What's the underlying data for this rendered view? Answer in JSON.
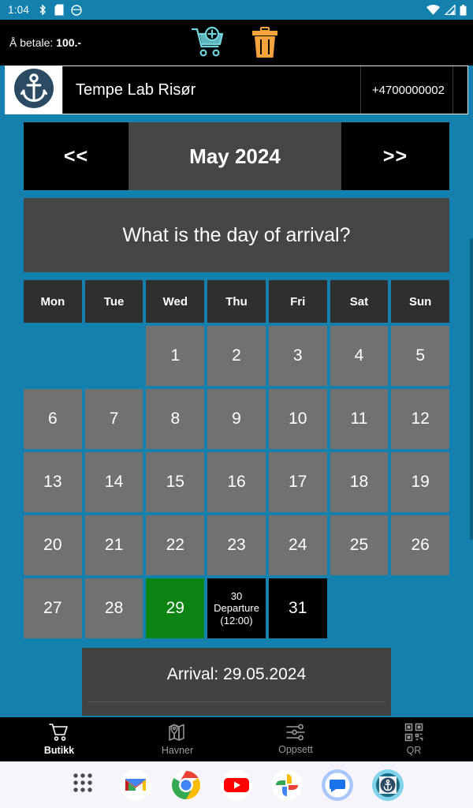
{
  "status_bar": {
    "time": "1:04",
    "icons": [
      "bluetooth-icon",
      "sd-card-icon",
      "circle-icon"
    ],
    "right_icons": [
      "wifi-icon",
      "cellular-signal-icon",
      "battery-icon"
    ]
  },
  "toolbar": {
    "pay_label": "Å betale:",
    "pay_amount": "100.-",
    "add_to_cart_icon": "cart-plus-icon",
    "delete_icon": "trash-can-icon"
  },
  "vendor": {
    "logo_icon": "anchor-icon",
    "name": "Tempe Lab Risør",
    "phone": "+4700000002"
  },
  "month_nav": {
    "prev_label": "<<",
    "next_label": ">>",
    "month_title": "May 2024"
  },
  "prompt": {
    "question": "What is the day of arrival?"
  },
  "calendar": {
    "day_headers": [
      "Mon",
      "Tue",
      "Wed",
      "Thu",
      "Fri",
      "Sat",
      "Sun"
    ],
    "weeks": [
      [
        {
          "label": "",
          "state": "empty"
        },
        {
          "label": "",
          "state": "empty"
        },
        {
          "label": "1",
          "state": "available"
        },
        {
          "label": "2",
          "state": "available"
        },
        {
          "label": "3",
          "state": "available"
        },
        {
          "label": "4",
          "state": "available"
        },
        {
          "label": "5",
          "state": "available"
        }
      ],
      [
        {
          "label": "6",
          "state": "available"
        },
        {
          "label": "7",
          "state": "available"
        },
        {
          "label": "8",
          "state": "available"
        },
        {
          "label": "9",
          "state": "available"
        },
        {
          "label": "10",
          "state": "available"
        },
        {
          "label": "11",
          "state": "available"
        },
        {
          "label": "12",
          "state": "available"
        }
      ],
      [
        {
          "label": "13",
          "state": "available"
        },
        {
          "label": "14",
          "state": "available"
        },
        {
          "label": "15",
          "state": "available"
        },
        {
          "label": "16",
          "state": "available"
        },
        {
          "label": "17",
          "state": "available"
        },
        {
          "label": "18",
          "state": "available"
        },
        {
          "label": "19",
          "state": "available"
        }
      ],
      [
        {
          "label": "20",
          "state": "available"
        },
        {
          "label": "21",
          "state": "available"
        },
        {
          "label": "22",
          "state": "available"
        },
        {
          "label": "23",
          "state": "available"
        },
        {
          "label": "24",
          "state": "available"
        },
        {
          "label": "25",
          "state": "available"
        },
        {
          "label": "26",
          "state": "available"
        }
      ],
      [
        {
          "label": "27",
          "state": "available"
        },
        {
          "label": "28",
          "state": "available"
        },
        {
          "label": "29",
          "state": "selected"
        },
        {
          "label": "30",
          "state": "marked",
          "note_line1": "Departure",
          "note_line2": "(12:00)"
        },
        {
          "label": "31",
          "state": "blackout"
        },
        {
          "label": "",
          "state": "empty"
        },
        {
          "label": "",
          "state": "empty"
        }
      ]
    ]
  },
  "arrival": {
    "summary": "Arrival: 29.05.2024"
  },
  "bottom_nav": {
    "items": [
      {
        "label": "Butikk",
        "icon": "shopping-cart-icon",
        "active": true
      },
      {
        "label": "Havner",
        "icon": "map-pin-icon",
        "active": false
      },
      {
        "label": "Oppsett",
        "icon": "sliders-icon",
        "active": false
      },
      {
        "label": "QR",
        "icon": "qr-code-icon",
        "active": false
      }
    ]
  },
  "dock": {
    "apps": [
      {
        "name": "app-drawer-icon"
      },
      {
        "name": "gmail-icon"
      },
      {
        "name": "chrome-icon"
      },
      {
        "name": "youtube-icon"
      },
      {
        "name": "google-photos-icon"
      },
      {
        "name": "messages-icon"
      },
      {
        "name": "anchor-app-icon"
      }
    ]
  },
  "colors": {
    "background_teal": "#1380AE",
    "panel_gray": "#454545",
    "day_gray": "#717171",
    "selected_green": "#0b8413",
    "marked_black": "#000000",
    "accent_orange": "#F5A councils"
  }
}
